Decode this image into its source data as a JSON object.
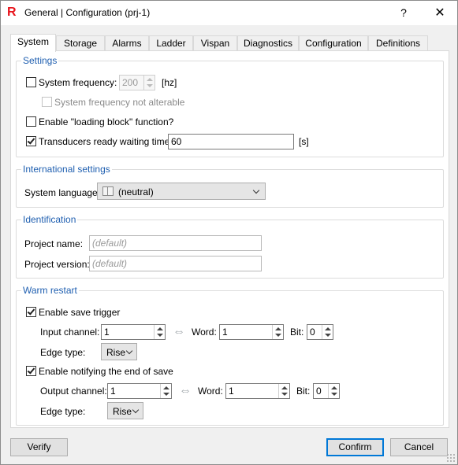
{
  "window": {
    "title": "General | Configuration (prj-1)",
    "help_label": "?",
    "close_label": "✕"
  },
  "tabs": [
    "System",
    "Storage",
    "Alarms",
    "Ladder",
    "Vispan",
    "Diagnostics",
    "Configuration",
    "Definitions"
  ],
  "active_tab": "System",
  "settings": {
    "title": "Settings",
    "system_frequency": {
      "label": "System frequency:",
      "value": "200",
      "unit": "[hz]",
      "checked": false
    },
    "not_alterable": {
      "label": "System frequency not alterable",
      "checked": false,
      "disabled": true
    },
    "loading_block": {
      "label": "Enable \"loading block\" function?",
      "checked": false
    },
    "transducers": {
      "label": "Transducers ready waiting time:",
      "value": "60",
      "unit": "[s]",
      "checked": true
    }
  },
  "international": {
    "title": "International settings",
    "language_label": "System language:",
    "language_value": "(neutral)"
  },
  "identification": {
    "title": "Identification",
    "project_name_label": "Project name:",
    "project_name_placeholder": "(default)",
    "project_version_label": "Project version:",
    "project_version_placeholder": "(default)"
  },
  "warm_restart": {
    "title": "Warm restart",
    "save_trigger": {
      "label": "Enable save trigger",
      "checked": true,
      "channel_label": "Input channel:",
      "channel_value": "1",
      "word_label": "Word:",
      "word_value": "1",
      "bit_label": "Bit:",
      "bit_value": "0",
      "edge_label": "Edge type:",
      "edge_value": "Rise"
    },
    "notify_end": {
      "label": "Enable notifying the end of save",
      "checked": true,
      "channel_label": "Output channel:",
      "channel_value": "1",
      "word_label": "Word:",
      "word_value": "1",
      "bit_label": "Bit:",
      "bit_value": "0",
      "edge_label": "Edge type:",
      "edge_value": "Rise"
    }
  },
  "footer": {
    "verify_label": "Verify",
    "confirm_label": "Confirm",
    "cancel_label": "Cancel"
  },
  "colors": {
    "accent": "#0078d7",
    "group_title": "#1f5fb0",
    "brand_icon": "#e8141c"
  }
}
